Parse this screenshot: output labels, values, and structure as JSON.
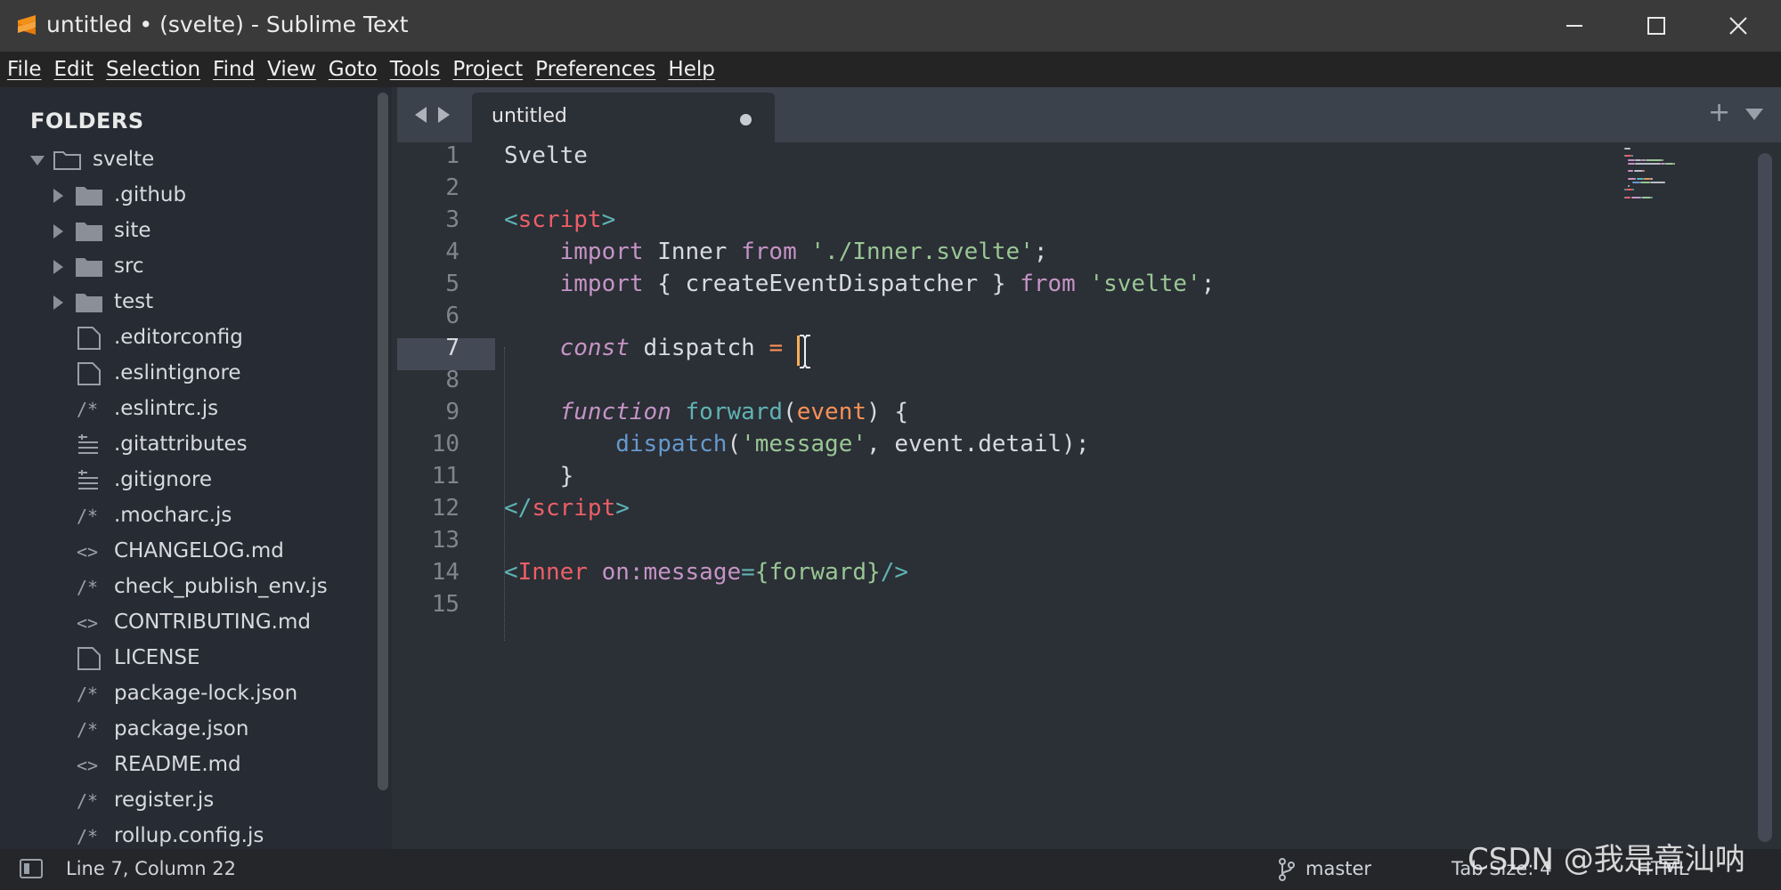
{
  "window": {
    "title": "untitled • (svelte) - Sublime Text"
  },
  "menu": [
    "File",
    "Edit",
    "Selection",
    "Find",
    "View",
    "Goto",
    "Tools",
    "Project",
    "Preferences",
    "Help"
  ],
  "sidebar": {
    "heading": "FOLDERS",
    "root": "svelte",
    "items": [
      {
        "label": ".github",
        "kind": "folder"
      },
      {
        "label": "site",
        "kind": "folder"
      },
      {
        "label": "src",
        "kind": "folder"
      },
      {
        "label": "test",
        "kind": "folder"
      },
      {
        "label": ".editorconfig",
        "kind": "file"
      },
      {
        "label": ".eslintignore",
        "kind": "file"
      },
      {
        "label": ".eslintrc.js",
        "kind": "js",
        "glyph": "/*"
      },
      {
        "label": ".gitattributes",
        "kind": "text"
      },
      {
        "label": ".gitignore",
        "kind": "text"
      },
      {
        "label": ".mocharc.js",
        "kind": "js",
        "glyph": "/*"
      },
      {
        "label": "CHANGELOG.md",
        "kind": "markup",
        "glyph": "<>"
      },
      {
        "label": "check_publish_env.js",
        "kind": "js",
        "glyph": "/*"
      },
      {
        "label": "CONTRIBUTING.md",
        "kind": "markup",
        "glyph": "<>"
      },
      {
        "label": "LICENSE",
        "kind": "file"
      },
      {
        "label": "package-lock.json",
        "kind": "js",
        "glyph": "/*"
      },
      {
        "label": "package.json",
        "kind": "js",
        "glyph": "/*"
      },
      {
        "label": "README.md",
        "kind": "markup",
        "glyph": "<>"
      },
      {
        "label": "register.js",
        "kind": "js",
        "glyph": "/*"
      },
      {
        "label": "rollup.config.js",
        "kind": "js",
        "glyph": "/*"
      }
    ]
  },
  "tabs": [
    {
      "label": "untitled",
      "dirty": true,
      "active": true
    }
  ],
  "editor": {
    "active_line": 7,
    "line_numbers": [
      "1",
      "2",
      "3",
      "4",
      "5",
      "6",
      "7",
      "8",
      "9",
      "10",
      "11",
      "12",
      "13",
      "14",
      "15"
    ],
    "lines": [
      [
        {
          "t": "Svelte",
          "c": "plain"
        }
      ],
      [],
      [
        {
          "t": "<",
          "c": "punct"
        },
        {
          "t": "script",
          "c": "tag"
        },
        {
          "t": ">",
          "c": "punct"
        }
      ],
      [
        {
          "t": "    import ",
          "c": "kw"
        },
        {
          "t": "Inner ",
          "c": "plain"
        },
        {
          "t": "from ",
          "c": "kw"
        },
        {
          "t": "'./Inner.svelte'",
          "c": "str"
        },
        {
          "t": ";",
          "c": "plain"
        }
      ],
      [
        {
          "t": "    import ",
          "c": "kw"
        },
        {
          "t": "{ createEventDispatcher } ",
          "c": "plain"
        },
        {
          "t": "from ",
          "c": "kw"
        },
        {
          "t": "'svelte'",
          "c": "str"
        },
        {
          "t": ";",
          "c": "plain"
        }
      ],
      [],
      [
        {
          "t": "    ",
          "c": "plain"
        },
        {
          "t": "const",
          "c": "kw",
          "i": true
        },
        {
          "t": " dispatch ",
          "c": "plain"
        },
        {
          "t": "=",
          "c": "op"
        },
        {
          "t": " ",
          "c": "plain"
        }
      ],
      [],
      [
        {
          "t": "    ",
          "c": "plain"
        },
        {
          "t": "function",
          "c": "kw",
          "i": true
        },
        {
          "t": " ",
          "c": "plain"
        },
        {
          "t": "forward",
          "c": "fn"
        },
        {
          "t": "(",
          "c": "plain"
        },
        {
          "t": "event",
          "c": "param"
        },
        {
          "t": ") {",
          "c": "plain"
        }
      ],
      [
        {
          "t": "        ",
          "c": "plain"
        },
        {
          "t": "dispatch",
          "c": "func"
        },
        {
          "t": "(",
          "c": "plain"
        },
        {
          "t": "'message'",
          "c": "str"
        },
        {
          "t": ", event.detail);",
          "c": "plain"
        }
      ],
      [
        {
          "t": "    }",
          "c": "plain"
        }
      ],
      [
        {
          "t": "</",
          "c": "punct"
        },
        {
          "t": "script",
          "c": "tag"
        },
        {
          "t": ">",
          "c": "punct"
        }
      ],
      [],
      [
        {
          "t": "<",
          "c": "punct"
        },
        {
          "t": "Inner",
          "c": "tag"
        },
        {
          "t": " ",
          "c": "plain"
        },
        {
          "t": "on:message",
          "c": "attr"
        },
        {
          "t": "=",
          "c": "punct"
        },
        {
          "t": "{forward}",
          "c": "str"
        },
        {
          "t": "/>",
          "c": "punct"
        }
      ],
      []
    ]
  },
  "status": {
    "position": "Line 7, Column 22",
    "branch": "master",
    "tab_size": "Tab Size: 4",
    "syntax": "HTML"
  },
  "watermark": "CSDN @我是章汕呐",
  "colors": {
    "caret": "#f9ae58",
    "keyword": "#c594c5",
    "string": "#99c794",
    "tag": "#ec5f67",
    "punct": "#5fb3b3",
    "function": "#6699cc",
    "param": "#f99157",
    "logo": "#f29018"
  },
  "icons": {
    "app": "sublime-logo-icon",
    "minimize": "minimize-icon",
    "maximize": "maximize-icon",
    "close": "close-icon",
    "folder": "folder-icon",
    "file": "file-icon",
    "branch": "git-branch-icon"
  }
}
